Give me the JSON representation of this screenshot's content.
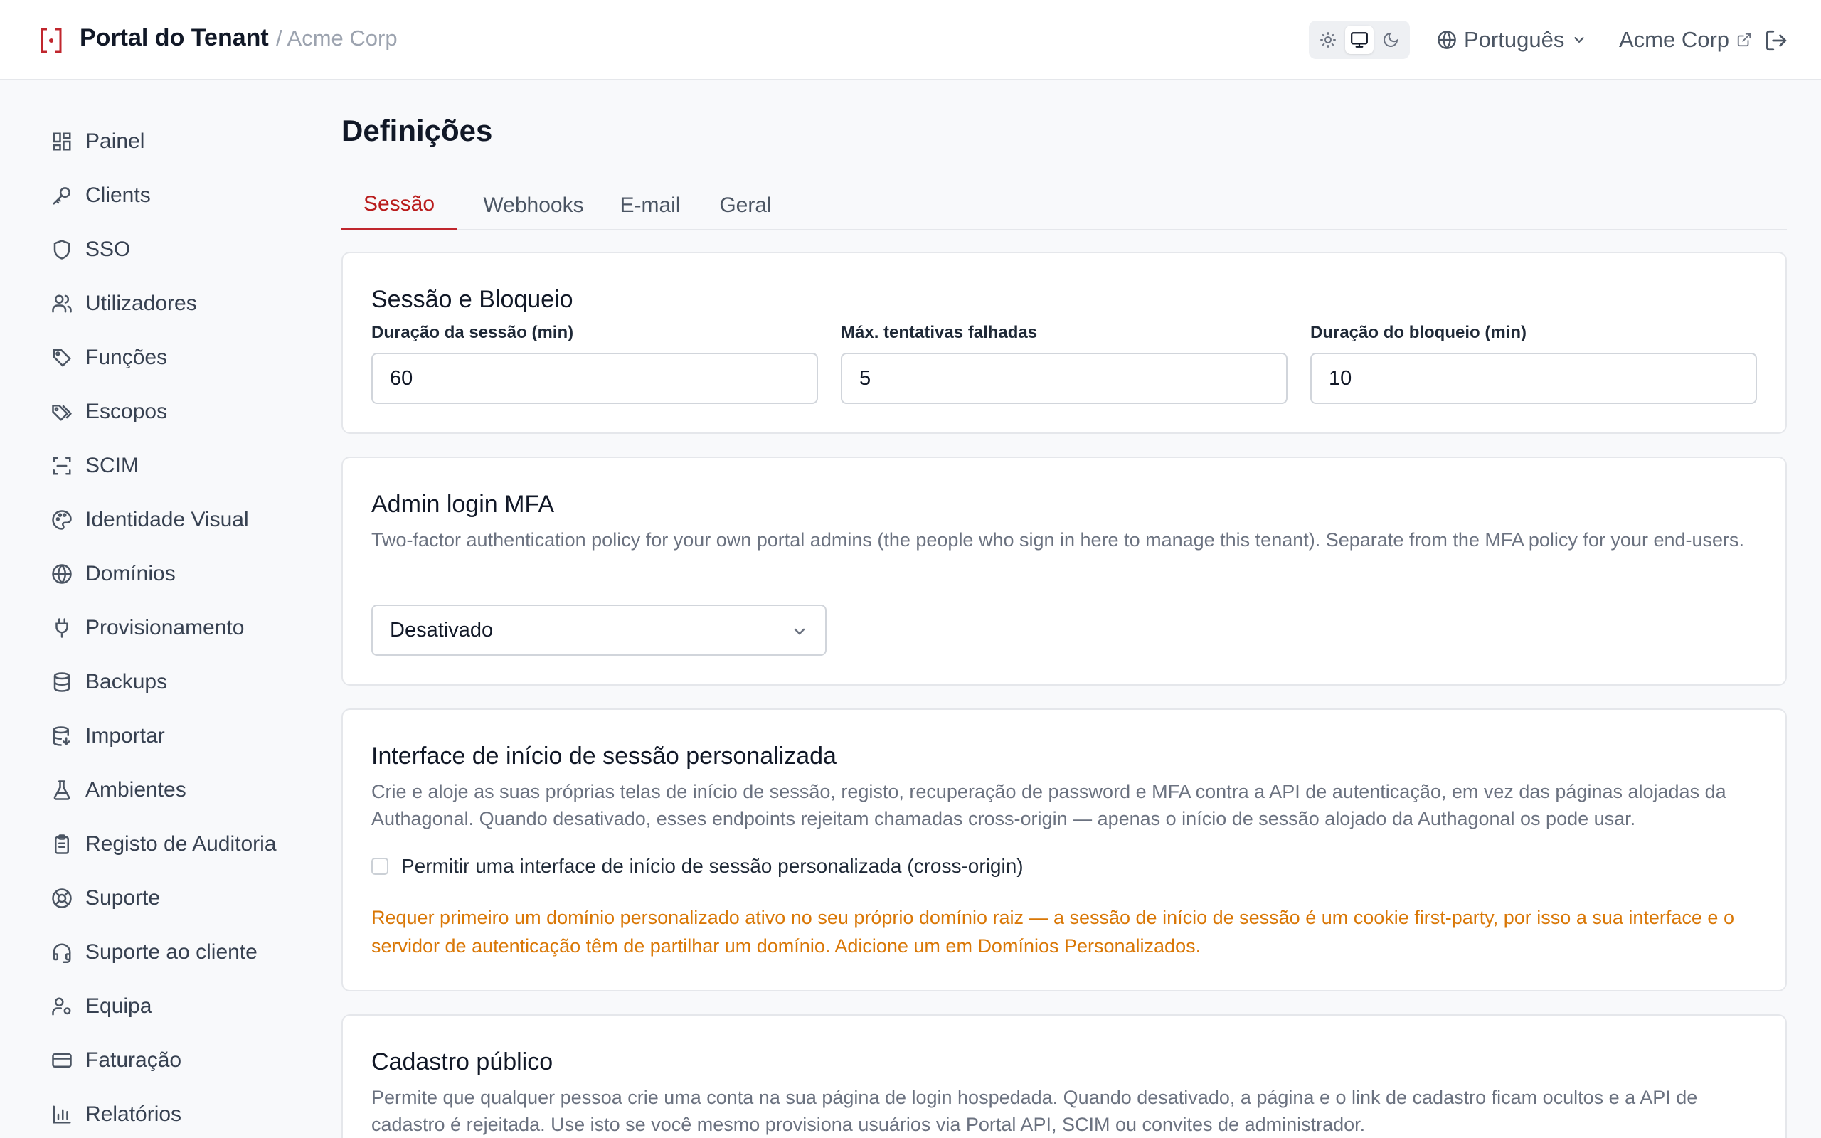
{
  "header": {
    "title": "Portal do Tenant",
    "org_breadcrumb": "/ Acme Corp",
    "theme_options": [
      "light",
      "system",
      "dark"
    ],
    "theme_active": "system",
    "language": "Português",
    "org_link": "Acme Corp"
  },
  "colors": {
    "accent": "#c0262d",
    "warning": "#d97706"
  },
  "sidebar": {
    "items": [
      {
        "label": "Painel",
        "icon": "dashboard-icon"
      },
      {
        "label": "Clients",
        "icon": "key-icon"
      },
      {
        "label": "SSO",
        "icon": "shield-icon"
      },
      {
        "label": "Utilizadores",
        "icon": "users-icon"
      },
      {
        "label": "Funções",
        "icon": "tag-icon"
      },
      {
        "label": "Escopos",
        "icon": "tags-icon"
      },
      {
        "label": "SCIM",
        "icon": "scan-icon"
      },
      {
        "label": "Identidade Visual",
        "icon": "palette-icon"
      },
      {
        "label": "Domínios",
        "icon": "globe-icon"
      },
      {
        "label": "Provisionamento",
        "icon": "plug-icon"
      },
      {
        "label": "Backups",
        "icon": "database-icon"
      },
      {
        "label": "Importar",
        "icon": "database-import-icon"
      },
      {
        "label": "Ambientes",
        "icon": "flask-icon"
      },
      {
        "label": "Registo de Auditoria",
        "icon": "clipboard-icon"
      },
      {
        "label": "Suporte",
        "icon": "lifebuoy-icon"
      },
      {
        "label": "Suporte ao cliente",
        "icon": "headset-icon"
      },
      {
        "label": "Equipa",
        "icon": "user-cog-icon"
      },
      {
        "label": "Faturação",
        "icon": "credit-card-icon"
      },
      {
        "label": "Relatórios",
        "icon": "bar-chart-icon"
      }
    ]
  },
  "main": {
    "title": "Definições",
    "tabs": [
      {
        "label": "Sessão",
        "active": true
      },
      {
        "label": "Webhooks",
        "active": false
      },
      {
        "label": "E-mail",
        "active": false
      },
      {
        "label": "Geral",
        "active": false
      }
    ],
    "session_card": {
      "title": "Sessão e Bloqueio",
      "fields": [
        {
          "label": "Duração da sessão (min)",
          "value": "60"
        },
        {
          "label": "Máx. tentativas falhadas",
          "value": "5"
        },
        {
          "label": "Duração do bloqueio (min)",
          "value": "10"
        }
      ]
    },
    "mfa_card": {
      "title": "Admin login MFA",
      "description": "Two-factor authentication policy for your own portal admins (the people who sign in here to manage this tenant). Separate from the MFA policy for your end-users.",
      "select_value": "Desativado"
    },
    "custom_login_card": {
      "title": "Interface de início de sessão personalizada",
      "description": "Crie e aloje as suas próprias telas de início de sessão, registo, recuperação de password e MFA contra a API de autenticação, em vez das páginas alojadas da Authagonal. Quando desativado, esses endpoints rejeitam chamadas cross-origin — apenas o início de sessão alojado da Authagonal os pode usar.",
      "checkbox_label": "Permitir uma interface de início de sessão personalizada (cross-origin)",
      "checkbox_checked": false,
      "warning": "Requer primeiro um domínio personalizado ativo no seu próprio domínio raiz — a sessão de início de sessão é um cookie first-party, por isso a sua interface e o servidor de autenticação têm de partilhar um domínio. Adicione um em Domínios Personalizados."
    },
    "public_signup_card": {
      "title": "Cadastro público",
      "description": "Permite que qualquer pessoa crie uma conta na sua página de login hospedada. Quando desativado, a página e o link de cadastro ficam ocultos e a API de cadastro é rejeitada. Use isto se você mesmo provisiona usuários via Portal API, SCIM ou convites de administrador."
    }
  }
}
